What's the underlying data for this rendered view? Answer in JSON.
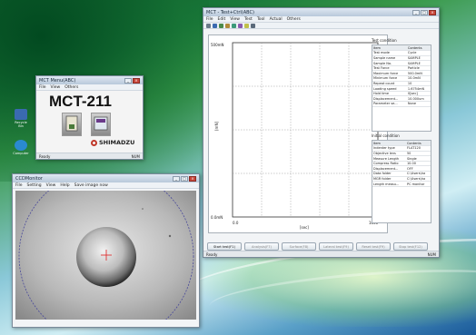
{
  "desktop": {
    "icons": [
      {
        "label": "Recycle Bin",
        "color": "#3a6ab0"
      },
      {
        "label": "Computer",
        "color": "#2a8ad0"
      }
    ]
  },
  "mct_menu": {
    "title": "MCT Menu(ABC)",
    "menus": [
      "File",
      "View",
      "Others"
    ],
    "model": "MCT-211",
    "brand": "SHIMADZU",
    "status_left": "Ready",
    "status_right": "NUM"
  },
  "test_window": {
    "title": "MCT - Test+Ctrl(ABC)",
    "menus": [
      "File",
      "Edit",
      "View",
      "Test",
      "Tool",
      "Actual",
      "Others"
    ],
    "y_axis_top": "500mN",
    "y_axis_bottom": "0.0mN",
    "y_axis_label": "[mN]",
    "x_axis_left": "0.0",
    "x_axis_right": "1000",
    "x_axis_label": "[sec]",
    "test_condition": {
      "title": "Test condition",
      "headers": [
        "Item",
        "Contents"
      ],
      "rows": [
        [
          "Test mode",
          "Cycle"
        ],
        [
          "Sample name",
          "SAMPLE"
        ],
        [
          "Sample No.",
          "SAMPLE"
        ],
        [
          "Test Force",
          "Particle"
        ],
        [
          "Maximum force",
          "500.0mN"
        ],
        [
          "Minimum force",
          "10.0mN"
        ],
        [
          "Repeat count",
          "10"
        ],
        [
          "Loading speed",
          "1.6754mN"
        ],
        [
          "Hold time",
          "0[sec]"
        ],
        [
          "Displacement...",
          "10.000um"
        ],
        [
          "Parameter se...",
          "None"
        ]
      ]
    },
    "initial_condition": {
      "title": "Initial condition",
      "headers": [
        "Item",
        "Contents"
      ],
      "rows": [
        [
          "Indenter type",
          "FLAT120"
        ],
        [
          "Objective lens",
          "50"
        ],
        [
          "Measure Length",
          "Single"
        ],
        [
          "Compress Ratio",
          "10.00"
        ],
        [
          "Displacement...",
          "OFF"
        ],
        [
          "Data folder",
          "C:\\Users\\ha"
        ],
        [
          "MGR folder",
          "C:\\Users\\ha"
        ],
        [
          "Length measu...",
          "PC monitor"
        ]
      ]
    },
    "buttons": [
      {
        "label": "Start test(F1)",
        "enabled": true
      },
      {
        "label": "Analysis(F7)",
        "enabled": false
      },
      {
        "label": "Surface(F8)",
        "enabled": false
      },
      {
        "label": "Lateral test(F9)",
        "enabled": false
      },
      {
        "label": "Reset test(F9)",
        "enabled": false
      },
      {
        "label": "Stop test(F12)",
        "enabled": false
      }
    ],
    "status_left": "Ready",
    "status_right": "NUM"
  },
  "ccd": {
    "title": "CCDMonitor",
    "menus": [
      "File",
      "Setting",
      "View",
      "Help",
      "Save image now"
    ]
  }
}
